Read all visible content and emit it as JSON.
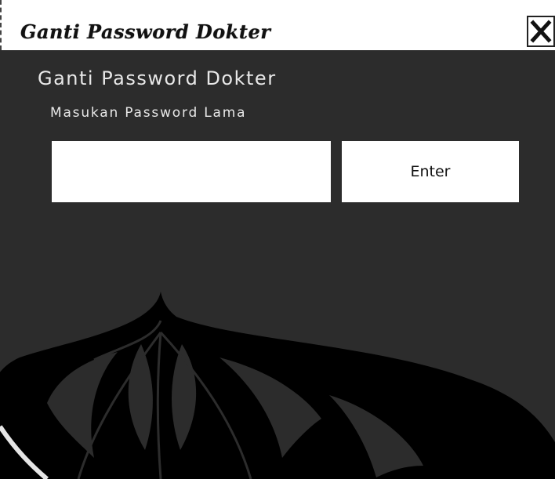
{
  "window": {
    "title": "Ganti Password Dokter"
  },
  "form": {
    "heading": "Ganti Password Dokter",
    "instruction": "Masukan Password Lama",
    "password_value": "",
    "enter_label": "Enter"
  },
  "icons": {
    "close": "close-icon",
    "background": "university-logo-watermark"
  },
  "colors": {
    "panel_background": "#2c2c2c",
    "watermark": "#000000",
    "text": "#e8e8e8"
  }
}
